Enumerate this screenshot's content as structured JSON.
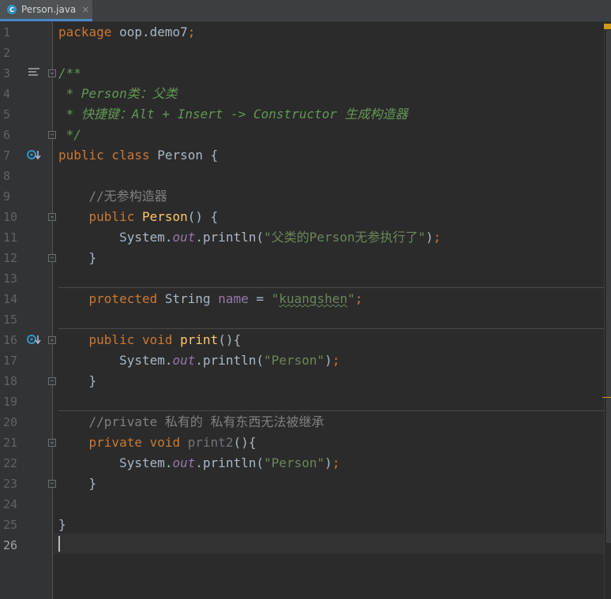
{
  "tab": {
    "label": "Person.java",
    "icon": "java-class-icon",
    "close": "×"
  },
  "lines": [
    {
      "n": "1"
    },
    {
      "n": "2"
    },
    {
      "n": "3"
    },
    {
      "n": "4"
    },
    {
      "n": "5"
    },
    {
      "n": "6"
    },
    {
      "n": "7"
    },
    {
      "n": "8"
    },
    {
      "n": "9"
    },
    {
      "n": "10"
    },
    {
      "n": "11"
    },
    {
      "n": "12"
    },
    {
      "n": "13"
    },
    {
      "n": "14"
    },
    {
      "n": "15"
    },
    {
      "n": "16"
    },
    {
      "n": "17"
    },
    {
      "n": "18"
    },
    {
      "n": "19"
    },
    {
      "n": "20"
    },
    {
      "n": "21"
    },
    {
      "n": "22"
    },
    {
      "n": "23"
    },
    {
      "n": "24"
    },
    {
      "n": "25"
    },
    {
      "n": "26"
    }
  ],
  "code": {
    "l1": {
      "kw": "package",
      "rest": " oop.demo7",
      "semi": ";"
    },
    "l3": "/**",
    "l4": " * Person类：父类",
    "l5": " * 快捷键：Alt + Insert -> Constructor 生成构造器",
    "l6": " */",
    "l7": {
      "kw": "public class",
      "rest": " Person {"
    },
    "l9": "    //无参构造器",
    "l10": {
      "indent": "    ",
      "kw": "public",
      "fn": "Person",
      "rest": "() {"
    },
    "l11": {
      "pre": "        System.",
      "stat": "out",
      "mid": ".println(",
      "str": "\"父类的Person无参执行了\"",
      "end": ")",
      "semi": ";"
    },
    "l12": "    }",
    "l14": {
      "indent": "    ",
      "kw": "protected",
      "type": " String ",
      "fld": "name",
      "eq": " = ",
      "q1": "\"",
      "str": "kuangshen",
      "q2": "\"",
      "semi": ";"
    },
    "l16": {
      "indent": "    ",
      "kw": "public void",
      "fn": "print",
      "rest": "(){"
    },
    "l17": {
      "pre": "        System.",
      "stat": "out",
      "mid": ".println(",
      "str": "\"Person\"",
      "end": ")",
      "semi": ";"
    },
    "l18": "    }",
    "l20": "    //private 私有的 私有东西无法被继承",
    "l21": {
      "indent": "    ",
      "kw": "private void",
      "fn": "print2",
      "rest": "(){"
    },
    "l22": {
      "pre": "        System.",
      "stat": "out",
      "mid": ".println(",
      "str": "\"Person\"",
      "end": ")",
      "semi": ";"
    },
    "l23": "    }",
    "l25": "}"
  },
  "colors": {
    "background": "#2b2b2b",
    "keyword": "#cc7832",
    "method": "#ffc66d",
    "string": "#6a8759",
    "doc": "#629755",
    "comment": "#808080",
    "field": "#9876aa",
    "text": "#a9b7c6"
  },
  "gutter_icons": {
    "line3": "doc-render-icon",
    "line7": "overridden-method-icon",
    "line16": "overridden-method-icon"
  }
}
